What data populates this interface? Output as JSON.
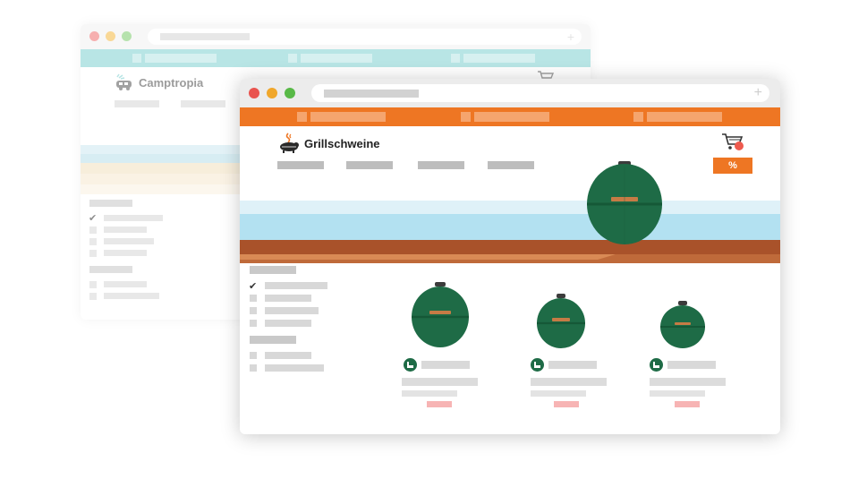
{
  "back_window": {
    "brand": {
      "name": "Camptropia",
      "logo_icon": "camper-van-icon"
    },
    "topbar_color": "#7fd1d0",
    "traffic_lights": [
      "#f06e6e",
      "#f5b942",
      "#7ccb6b"
    ]
  },
  "front_window": {
    "brand": {
      "name": "Grillschweine",
      "logo_icon": "grill-pig-icon"
    },
    "topbar_color": "#ee7623",
    "traffic_lights": [
      "#e9544f",
      "#f0a72b",
      "#58b947"
    ],
    "promo_button": {
      "label": "%"
    },
    "cart_icon": "shopping-cart-icon",
    "products": [
      {
        "name": "product-large",
        "icon": "grill-icon"
      },
      {
        "name": "product-medium",
        "icon": "grill-icon"
      },
      {
        "name": "product-small",
        "icon": "grill-icon"
      }
    ]
  },
  "colors": {
    "grill_green": "#1e6b46",
    "handle_copper": "#c67b45",
    "sky_blue": "#b3e1f1",
    "wood_brown": "#a9522a",
    "price_pink": "#f7b4b4"
  }
}
